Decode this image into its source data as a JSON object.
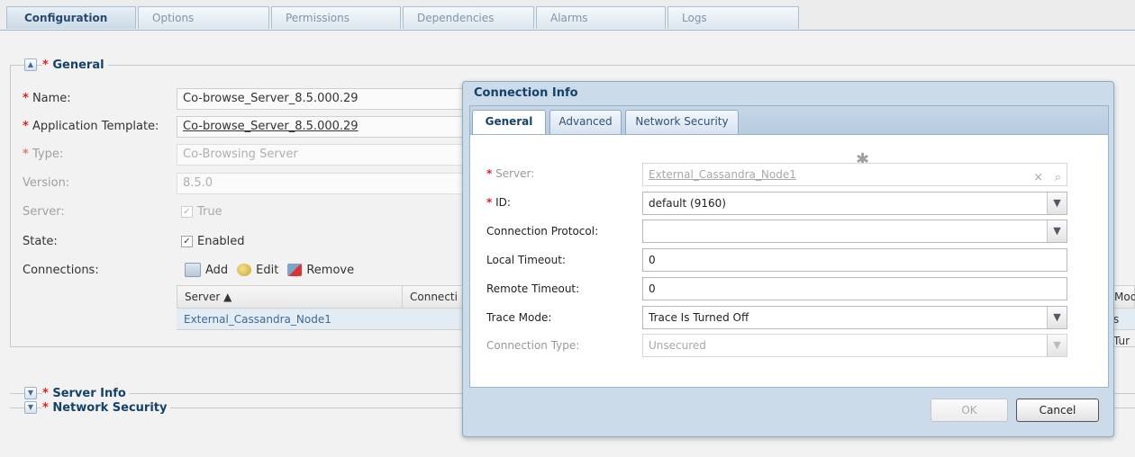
{
  "tabs": [
    "Configuration",
    "Options",
    "Permissions",
    "Dependencies",
    "Alarms",
    "Logs"
  ],
  "sections": {
    "general": "General",
    "server_info": "Server Info",
    "network_security": "Network Security"
  },
  "form": {
    "name_label": "Name:",
    "name_value": "Co-browse_Server_8.5.000.29",
    "app_template_label": "Application Template:",
    "app_template_value": "Co-browse_Server_8.5.000.29",
    "type_label": "Type:",
    "type_value": "Co-Browsing Server",
    "version_label": "Version:",
    "version_value": "8.5.0",
    "server_label": "Server:",
    "server_value": "True",
    "state_label": "State:",
    "state_value": "Enabled",
    "connections_label": "Connections:"
  },
  "connections": {
    "toolbar": {
      "add": "Add",
      "edit": "Edit",
      "remove": "Remove"
    },
    "columns": [
      "Server ▲",
      "Connecti",
      "Mode"
    ],
    "row": {
      "server": "External_Cassandra_Node1",
      "mode_fragment": "s Tur"
    }
  },
  "dialog": {
    "title": "Connection Info",
    "tabs": [
      "General",
      "Advanced",
      "Network Security"
    ],
    "fields": {
      "server_label": "Server:",
      "server_value": "External_Cassandra_Node1",
      "id_label": "ID:",
      "id_value": "default (9160)",
      "protocol_label": "Connection Protocol:",
      "protocol_value": "",
      "local_timeout_label": "Local Timeout:",
      "local_timeout_value": "0",
      "remote_timeout_label": "Remote Timeout:",
      "remote_timeout_value": "0",
      "trace_mode_label": "Trace Mode:",
      "trace_mode_value": "Trace Is Turned Off",
      "conn_type_label": "Connection Type:",
      "conn_type_value": "Unsecured"
    },
    "buttons": {
      "ok": "OK",
      "cancel": "Cancel"
    }
  },
  "colors": {
    "accent": "#15416b",
    "link": "#3d6b95",
    "required": "#dd2222",
    "dialog_bg": "#ccdbe9"
  },
  "icons": {
    "collapse": "chevron-up-icon",
    "expand": "chevron-down-icon",
    "clear": "clear-x-icon",
    "browse": "magnifier-icon",
    "add": "add-icon",
    "edit": "edit-icon",
    "remove": "remove-icon"
  }
}
